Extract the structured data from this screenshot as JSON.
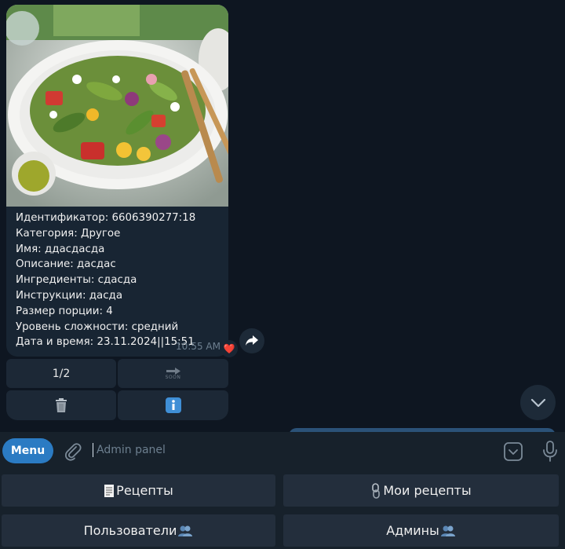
{
  "message": {
    "caption_lines": [
      "Идентификатор: 6606390277:18",
      "Категория: Другое",
      "Имя: ддасдасда",
      "Описание: дасдас",
      "Ингредиенты: сдасда",
      "Инструкции: дасда",
      "Размер порции: 4",
      "Уровень сложности: средний",
      "Дата и время: 23.11.2024||15:51"
    ],
    "time": "10:55 AM",
    "reaction": "❤️"
  },
  "inline_keyboard": {
    "page": "1/2",
    "next_label": "SOON"
  },
  "composer": {
    "menu_label": "Menu",
    "placeholder": "Admin panel"
  },
  "reply_keyboard": {
    "recipes": "Рецепты",
    "my_recipes": "Мои рецепты",
    "users": "Пользователи",
    "admins": "Админы"
  },
  "colors": {
    "background": "#0e1621",
    "bubble": "#182533",
    "accent": "#2b7bc3",
    "keyboard_button": "#232e3c"
  }
}
